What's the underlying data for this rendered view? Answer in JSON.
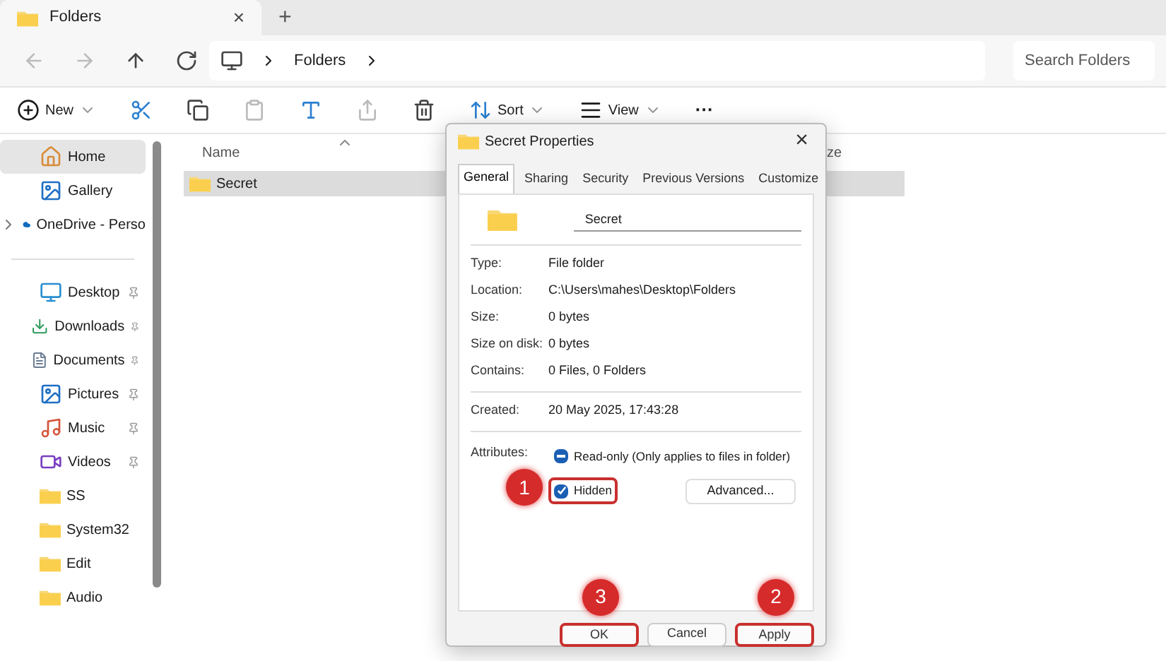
{
  "tab": {
    "title": "Folders",
    "close": "×",
    "new_tab": "+"
  },
  "address": {
    "crumbs": [
      "Folders"
    ],
    "search_placeholder": "Search Folders"
  },
  "toolbar": {
    "new": "New",
    "sort": "Sort",
    "view": "View",
    "more": "···"
  },
  "sidebar": {
    "items": [
      {
        "label": "Home",
        "kind": "home",
        "selected": true,
        "pinned": false,
        "expandable": false,
        "group_start": false
      },
      {
        "label": "Gallery",
        "kind": "gallery",
        "selected": false,
        "pinned": false,
        "expandable": false,
        "group_start": false
      },
      {
        "label": "OneDrive - Perso",
        "kind": "cloud",
        "selected": false,
        "pinned": false,
        "expandable": true,
        "group_start": false
      },
      {
        "label": "Desktop",
        "kind": "desktop",
        "selected": false,
        "pinned": true,
        "expandable": false,
        "group_start": true
      },
      {
        "label": "Downloads",
        "kind": "download",
        "selected": false,
        "pinned": true,
        "expandable": false,
        "group_start": false
      },
      {
        "label": "Documents",
        "kind": "document",
        "selected": false,
        "pinned": true,
        "expandable": false,
        "group_start": false
      },
      {
        "label": "Pictures",
        "kind": "gallery",
        "selected": false,
        "pinned": true,
        "expandable": false,
        "group_start": false
      },
      {
        "label": "Music",
        "kind": "music",
        "selected": false,
        "pinned": true,
        "expandable": false,
        "group_start": false
      },
      {
        "label": "Videos",
        "kind": "video",
        "selected": false,
        "pinned": true,
        "expandable": false,
        "group_start": false
      },
      {
        "label": "SS",
        "kind": "folder",
        "selected": false,
        "pinned": false,
        "expandable": false,
        "group_start": false
      },
      {
        "label": "System32",
        "kind": "folder",
        "selected": false,
        "pinned": false,
        "expandable": false,
        "group_start": false
      },
      {
        "label": "Edit",
        "kind": "folder",
        "selected": false,
        "pinned": false,
        "expandable": false,
        "group_start": false
      },
      {
        "label": "Audio",
        "kind": "folder",
        "selected": false,
        "pinned": false,
        "expandable": false,
        "group_start": false
      }
    ]
  },
  "file_list": {
    "columns": [
      "Name",
      "ze"
    ],
    "rows": [
      {
        "name": "Secret",
        "selected": true
      }
    ]
  },
  "dialog": {
    "title": "Secret Properties",
    "close": "×",
    "tabs": [
      {
        "label": "General",
        "selected": true
      },
      {
        "label": "Sharing",
        "selected": false
      },
      {
        "label": "Security",
        "selected": false
      },
      {
        "label": "Previous Versions",
        "selected": false
      },
      {
        "label": "Customize",
        "selected": false
      }
    ],
    "name_value": "Secret",
    "groups": [
      [
        {
          "label": "Type:",
          "value": "File folder"
        },
        {
          "label": "Location:",
          "value": "C:\\Users\\mahes\\Desktop\\Folders"
        },
        {
          "label": "Size:",
          "value": "0 bytes"
        },
        {
          "label": "Size on disk:",
          "value": "0 bytes"
        },
        {
          "label": "Contains:",
          "value": "0 Files, 0 Folders"
        }
      ],
      [
        {
          "label": "Created:",
          "value": "20 May 2025, 17:43:28"
        }
      ]
    ],
    "attributes_label": "Attributes:",
    "attributes": [
      {
        "label": "Read-only (Only applies to files in folder)",
        "checked": false,
        "mixed": true,
        "highlighted": false
      },
      {
        "label": "Hidden",
        "checked": true,
        "marker": "1",
        "highlighted": true
      }
    ],
    "advanced": "Advanced...",
    "buttons": [
      {
        "label": "OK",
        "marker": "3",
        "highlighted": true
      },
      {
        "label": "Cancel",
        "highlighted": false
      },
      {
        "label": "Apply",
        "marker": "2",
        "highlighted": true
      }
    ]
  }
}
